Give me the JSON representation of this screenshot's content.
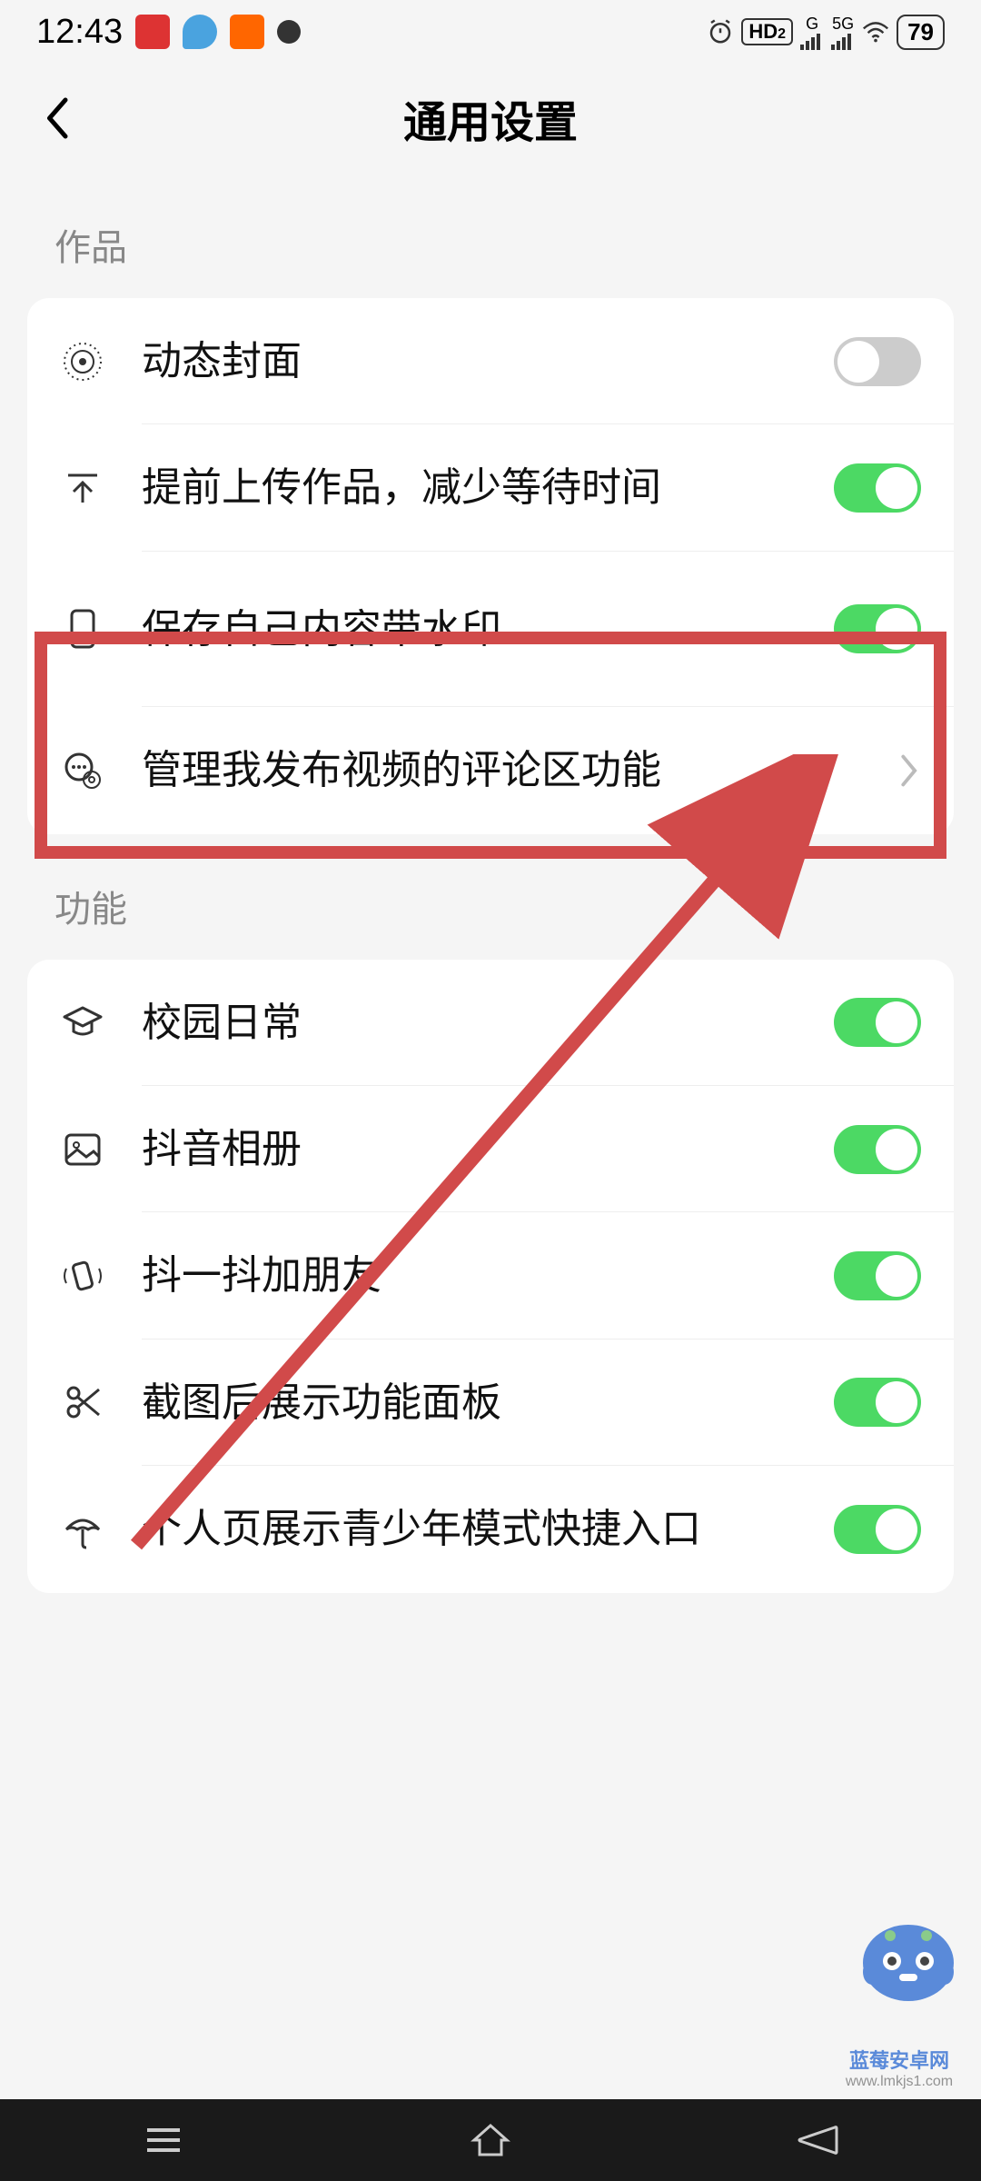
{
  "status": {
    "time": "12:43",
    "hd": "HD",
    "hd_sub": "2",
    "net1": "G",
    "net2": "5G",
    "battery": "79"
  },
  "header": {
    "title": "通用设置"
  },
  "sections": {
    "works": {
      "label": "作品",
      "items": [
        {
          "label": "动态封面",
          "toggle": false
        },
        {
          "label": "提前上传作品，减少等待时间",
          "toggle": true
        },
        {
          "label": "保存自己内容带水印",
          "toggle": true
        },
        {
          "label": "管理我发布视频的评论区功能",
          "chevron": true
        }
      ]
    },
    "features": {
      "label": "功能",
      "items": [
        {
          "label": "校园日常",
          "toggle": true
        },
        {
          "label": "抖音相册",
          "toggle": true
        },
        {
          "label": "抖一抖加朋友",
          "toggle": true
        },
        {
          "label": "截图后展示功能面板",
          "toggle": true
        },
        {
          "label": "个人页展示青少年模式快捷入口",
          "toggle": true
        }
      ]
    }
  },
  "watermark": {
    "line1": "蓝莓安卓网",
    "line2": "www.lmkjs1.com"
  },
  "annotation": {
    "highlight_color": "#d14a4a"
  }
}
